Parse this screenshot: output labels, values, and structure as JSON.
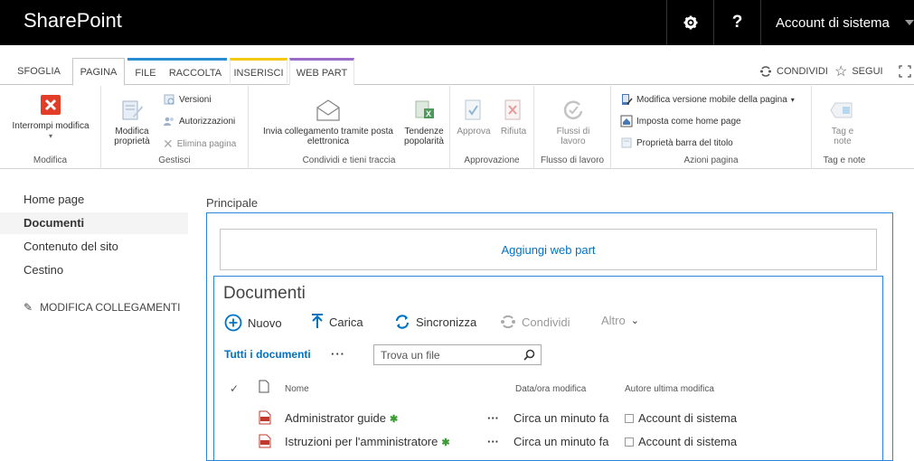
{
  "suite_bar": {
    "brand": "SharePoint",
    "help_label": "?",
    "account": "Account di sistema"
  },
  "ribbon_tabs": {
    "items": [
      {
        "label": "SFOGLIA"
      },
      {
        "label": "PAGINA"
      },
      {
        "label": "FILE"
      },
      {
        "label": "RACCOLTA"
      },
      {
        "label": "INSERISCI"
      },
      {
        "label": "WEB PART"
      }
    ],
    "share": "CONDIVIDI",
    "follow": "SEGUI"
  },
  "ribbon": {
    "modifica": {
      "stop_edit": "Interrompi modifica",
      "label": "Modifica"
    },
    "gestisci": {
      "edit_props": "Modifica proprietà",
      "versions": "Versioni",
      "permissions": "Autorizzazioni",
      "delete_page": "Elimina pagina",
      "label": "Gestisci"
    },
    "condividi": {
      "send_link": "Invia collegamento tramite posta elettronica",
      "popularity": "Tendenze popolarità",
      "label": "Condividi e tieni traccia"
    },
    "approvazione": {
      "approve": "Approva",
      "reject": "Rifiuta",
      "label": "Approvazione"
    },
    "flusso": {
      "workflows": "Flussi di lavoro",
      "label": "Flusso di lavoro"
    },
    "azioni": {
      "mobile": "Modifica versione mobile della pagina",
      "homepage": "Imposta come home page",
      "titlebar": "Proprietà barra del titolo",
      "label": "Azioni pagina"
    },
    "tag": {
      "tags": "Tag e note",
      "label": "Tag e note"
    }
  },
  "left_nav": {
    "items": [
      "Home page",
      "Documenti",
      "Contenuto del sito",
      "Cestino"
    ],
    "edit_links": "MODIFICA COLLEGAMENTI"
  },
  "main": {
    "zone_label": "Principale",
    "add_web_part": "Aggiungi web part",
    "webpart_title": "Documenti",
    "commands": {
      "new": "Nuovo",
      "upload": "Carica",
      "sync": "Sincronizza",
      "share": "Condividi",
      "more": "Altro"
    },
    "view": "Tutti i documenti",
    "view_more": "···",
    "search_placeholder": "Trova un file",
    "columns": {
      "name": "Nome",
      "modified": "Data/ora modifica",
      "author": "Autore ultima modifica"
    },
    "rows": [
      {
        "name": "Administrator guide",
        "new_mark": "✱",
        "dots": "···",
        "modified": "Circa un minuto fa",
        "author": "Account di sistema"
      },
      {
        "name": "Istruzioni per l'amministratore",
        "new_mark": "✱",
        "dots": "···",
        "modified": "Circa un minuto fa",
        "author": "Account di sistema"
      }
    ]
  }
}
